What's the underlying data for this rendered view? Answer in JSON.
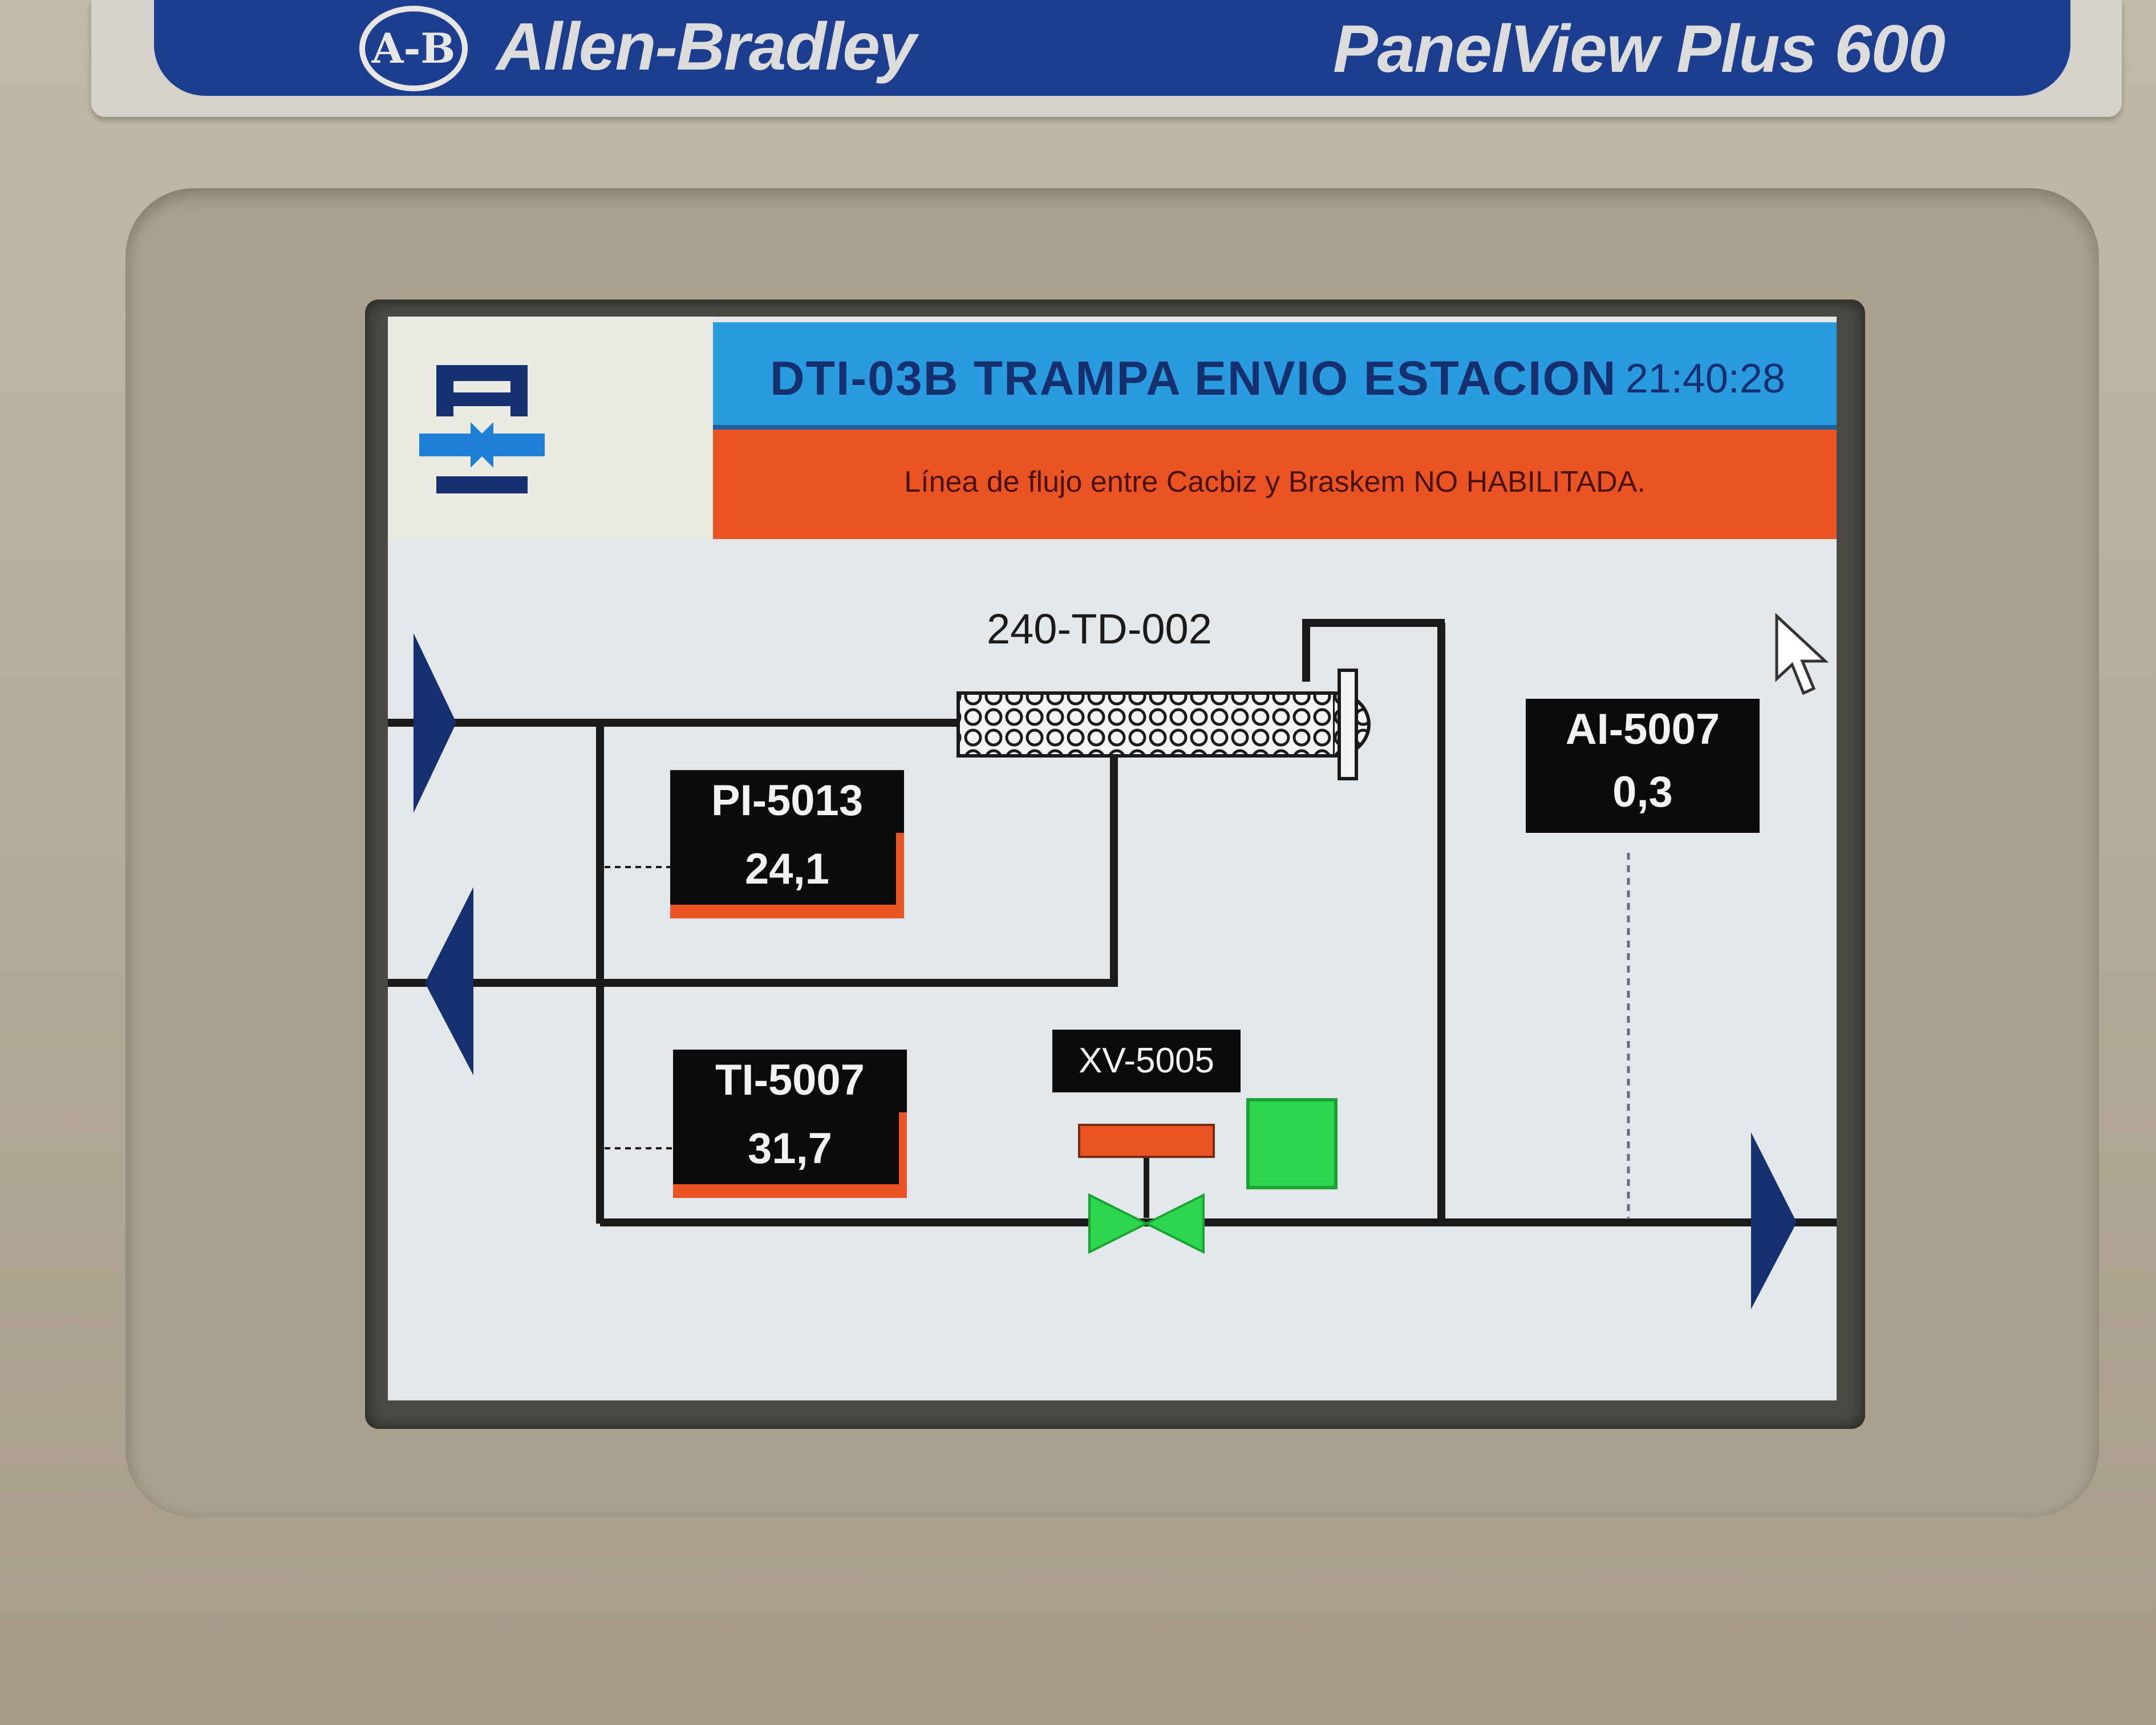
{
  "device": {
    "brand_logo": "A-B",
    "brand": "Allen-Bradley",
    "model": "PanelView Plus 600"
  },
  "header": {
    "company_logo_icon": "company-logo-icon",
    "company_text": "",
    "title": "DTI-03B TRAMPA ENVIO ESTACION",
    "clock": "21:40:28",
    "alarm_message": "Línea de flujo entre Cacbiz y Braskem NO HABILITADA."
  },
  "diagram": {
    "equipment_label": "240-TD-002",
    "pipe_color": "#1a1a1a",
    "valve_color": "#2dd74d",
    "accent_color": "#ea5425"
  },
  "tags": {
    "pi": {
      "name": "PI-5013",
      "value": "24,1"
    },
    "ti": {
      "name": "TI-5007",
      "value": "31,7"
    },
    "ai": {
      "name": "AI-5007",
      "value": "0,3"
    },
    "xv": {
      "name": "XV-5005",
      "state_color": "#2dd74d"
    }
  }
}
